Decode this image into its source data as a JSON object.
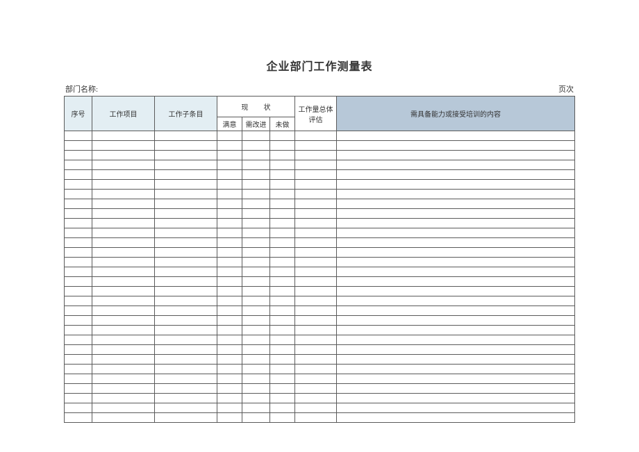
{
  "title": "企业部门工作测量表",
  "meta": {
    "dept_label": "部门名称:",
    "page_label": "页次"
  },
  "headers": {
    "seq": "序号",
    "item": "工作项目",
    "sub": "工作子条目",
    "status_group": "现状",
    "status_ok": "满意",
    "status_improve": "需改进",
    "status_none": "未做",
    "eval": "工作量总体评估",
    "need": "需具备能力或接受培训的内容"
  },
  "rows_count": 30
}
